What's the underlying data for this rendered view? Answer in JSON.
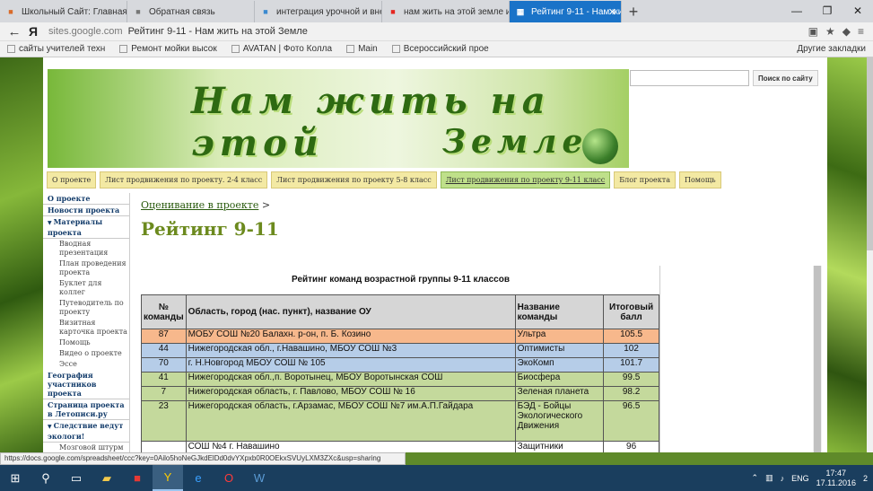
{
  "browser": {
    "tabs": [
      {
        "label": "Школьный Сайт: Главная",
        "icon": "site-icon",
        "color": "#d96b2a"
      },
      {
        "label": "Обратная связь",
        "icon": "doc-icon",
        "color": "#777777"
      },
      {
        "label": "интеграция урочной и вне",
        "icon": "site-icon",
        "color": "#3b8ad0"
      },
      {
        "label": "нам жить на этой земле ис",
        "icon": "yandex-icon",
        "color": "#e52620"
      }
    ],
    "active_tab": {
      "label": "Рейтинг 9-11 - Нам жить",
      "icon": "sites-icon"
    },
    "back_glyph": "←",
    "yandex_glyph": "Я",
    "url_host": "sites.google.com",
    "page_title": "Рейтинг 9-11 - Нам жить на этой Земле",
    "bookmarks": [
      "сайты учителей техн",
      "Ремонт мойки высок",
      "AVATAN | Фото Колла",
      "Main",
      "Всероссийский прое"
    ],
    "other_bookmarks": "Другие закладки"
  },
  "site": {
    "banner_line1": "Нам жить на этой",
    "banner_line2": "Земле",
    "search_button": "Поиск по сайту",
    "search_placeholder": "",
    "nav": [
      "О проекте",
      "Лист продвижения по проекту. 2-4 класс",
      "Лист продвижения по проекту 5-8 класс",
      "Лист продвижения по проекту 9-11 класс",
      "Блог проекта",
      "Помощь"
    ],
    "sidebar": [
      {
        "label": "О проекте",
        "level": 1
      },
      {
        "label": "Новости проекта",
        "level": 1
      },
      {
        "label": "Материалы проекта",
        "level": 1,
        "expanded": true
      },
      {
        "label": "Вводная презентация",
        "level": 2
      },
      {
        "label": "План проведения проекта",
        "level": 2
      },
      {
        "label": "Буклет для коллег",
        "level": 2
      },
      {
        "label": "Путеводитель по проекту",
        "level": 2
      },
      {
        "label": "Визитная карточка проекта",
        "level": 2
      },
      {
        "label": "Помощь",
        "level": 2
      },
      {
        "label": "Видео о проекте",
        "level": 2
      },
      {
        "label": "Эссе",
        "level": 2
      },
      {
        "label": "География участников проекта",
        "level": 1
      },
      {
        "label": "Страница проекта в Летописи.ру",
        "level": 1
      },
      {
        "label": "Следствие ведут экологи!",
        "level": 1,
        "expanded": true
      },
      {
        "label": "Мозговой штурм",
        "level": 2
      }
    ],
    "breadcrumb_link": "Оценивание в проекте",
    "breadcrumb_sep": ">",
    "title": "Рейтинг 9-11"
  },
  "table": {
    "caption": "Рейтинг команд возрастной группы 9-11 классов",
    "headers": [
      "№ команды",
      "Область, город (нас. пункт), название ОУ",
      "Название команды",
      "Итоговый балл"
    ],
    "rows": [
      {
        "n": "87",
        "place": "МОБУ СОШ №20 Балахн. р-он, п. Б. Козино",
        "team": "Ультра",
        "score": "105.5",
        "style": "orange"
      },
      {
        "n": "44",
        "place": "Нижегородская обл., г.Навашино, МБОУ СОШ №3",
        "team": "Оптимисты",
        "score": "102",
        "style": "blue"
      },
      {
        "n": "70",
        "place": "г. Н.Новгород МБОУ СОШ № 105",
        "team": "ЭкоКомп",
        "score": "101.7",
        "style": "blue"
      },
      {
        "n": "41",
        "place": "Нижегородская обл.,п. Воротынец, МБОУ Воротынская СОШ",
        "team": "Биосфера",
        "score": "99.5",
        "style": "green"
      },
      {
        "n": "7",
        "place": "Нижегородская область, г. Павлово, МБОУ СОШ № 16",
        "team": "Зеленая планета",
        "score": "98.2",
        "style": "green"
      },
      {
        "n": "23",
        "place": "Нижегородская область, г.Арзамас, МБОУ СОШ №7 им.А.П.Гайдара",
        "team": "БЭД - Бойцы Экологического Движения",
        "score": "96.5",
        "style": "green tall"
      },
      {
        "n": "",
        "place": "СОШ №4 г. Навашино",
        "team": "Защитники",
        "score": "96",
        "style": "white"
      }
    ]
  },
  "status_url": "https://docs.google.com/spreadsheet/ccc?key=0Ailo5hoNeGJkdElDd0dvYXpxb0R0OEkxSVUyLXM3ZXc&usp=sharing",
  "taskbar": {
    "lang": "ENG",
    "time": "17:47",
    "date": "17.11.2016",
    "notif": "2"
  }
}
